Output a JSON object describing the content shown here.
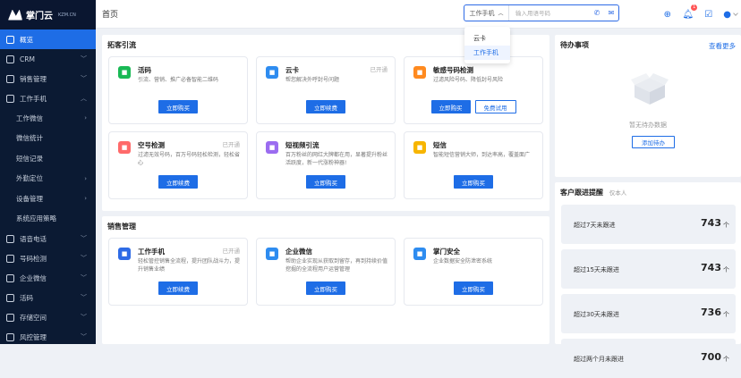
{
  "brand": {
    "name": "掌门云",
    "domain": "KZM.CN"
  },
  "sidebar": {
    "items": [
      {
        "label": "概览",
        "icon": "home-icon",
        "active": true
      },
      {
        "label": "CRM",
        "icon": "user-icon"
      },
      {
        "label": "销售管理",
        "icon": "sales-icon"
      },
      {
        "label": "工作手机",
        "icon": "phone-icon",
        "expanded": true
      }
    ],
    "sub": [
      "工作微信",
      "微信统计",
      "短信记录",
      "外勤定位",
      "设备管理",
      "系统应用策略"
    ],
    "bottom": [
      {
        "label": "语音电话",
        "icon": "voice-icon"
      },
      {
        "label": "号码检测",
        "icon": "number-check-icon"
      },
      {
        "label": "企业微信",
        "icon": "wecom-icon"
      },
      {
        "label": "活码",
        "icon": "qrcode-icon"
      },
      {
        "label": "存储空间",
        "icon": "storage-icon"
      },
      {
        "label": "风控管理",
        "icon": "risk-icon"
      }
    ]
  },
  "topbar": {
    "crumb": "首页",
    "select": "工作手机",
    "search_placeholder": "输入用语号码",
    "notif_count": "1"
  },
  "dropdown": {
    "options": [
      "云卡",
      "工作手机"
    ]
  },
  "acquire": {
    "title": "拓客引流",
    "cards": [
      {
        "name": "活码",
        "tag": "",
        "desc": "引流、营销、推广必备智能二维码",
        "color": "#19b955",
        "btns": [
          "立即购买"
        ]
      },
      {
        "name": "云卡",
        "tag": "已开通",
        "desc": "帮您解决外呼封号问题",
        "color": "#2e8cf0",
        "btns": [
          "立即续费"
        ]
      },
      {
        "name": "敏感号码检测",
        "tag": "",
        "desc": "过滤风险号码、降低封号风险",
        "color": "#ff8a1f",
        "btns": [
          "立即购买",
          "免费试用"
        ]
      },
      {
        "name": "空号检测",
        "tag": "已开通",
        "desc": "过滤无效号码，百万号码轻松检测，轻松省心",
        "color": "#ff6a6a",
        "btns": [
          "立即续费"
        ]
      },
      {
        "name": "短视频引流",
        "tag": "",
        "desc": "百万粉丝的网红大牌都在用，显著提升粉丝活跃度，新一代涨粉神器!",
        "color": "#9b6cf0",
        "btns": [
          "立即购买"
        ]
      },
      {
        "name": "短信",
        "tag": "",
        "desc": "智能短信营销大师，到达率高，覆盖面广",
        "color": "#f7b500",
        "btns": [
          "立即购买"
        ]
      }
    ]
  },
  "sales": {
    "title": "销售管理",
    "cards": [
      {
        "name": "工作手机",
        "tag": "已开通",
        "desc": "轻松管控销售全流程，提升团队战斗力，提升销售业绩",
        "color": "#2e6be6",
        "btns": [
          "立即续费"
        ]
      },
      {
        "name": "企业微信",
        "tag": "",
        "desc": "帮助企业实现从获取到留存，再到持续价值挖掘的全流程用户运营管理",
        "color": "#2e8cf0",
        "btns": [
          "立即购买"
        ]
      },
      {
        "name": "掌门安全",
        "tag": "",
        "desc": "企业数据安全防泄密系统",
        "color": "#2e8cf0",
        "btns": [
          "立即购买"
        ]
      }
    ]
  },
  "todo": {
    "title": "待办事项",
    "more": "查看更多",
    "empty": "暂无待办数据",
    "add": "添加待办"
  },
  "followup": {
    "title": "客户跟进提醒",
    "subtitle": "仅本人",
    "rows": [
      {
        "label": "超过7天未跟进",
        "value": "743",
        "unit": "个"
      },
      {
        "label": "超过15天未跟进",
        "value": "743",
        "unit": "个"
      },
      {
        "label": "超过30天未跟进",
        "value": "736",
        "unit": "个"
      },
      {
        "label": "超过两个月未跟进",
        "value": "700",
        "unit": "个"
      }
    ]
  }
}
